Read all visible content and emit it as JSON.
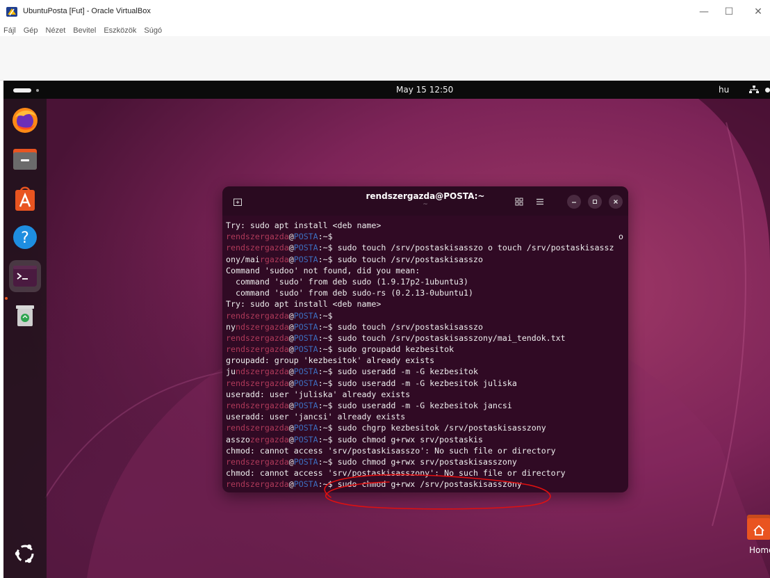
{
  "host": {
    "title": "UbuntuPosta [Fut] - Oracle VirtualBox",
    "menu": [
      "Fájl",
      "Gép",
      "Nézet",
      "Bevitel",
      "Eszközök",
      "Súgó"
    ],
    "controls": {
      "minimize": "—",
      "maximize": "☐",
      "close": "✕"
    }
  },
  "guest": {
    "topbar": {
      "clock": "May 15  12:50",
      "lang": "hu"
    },
    "dock": {
      "items": [
        "firefox-icon",
        "files-icon",
        "app-center-icon",
        "help-icon",
        "terminal-icon",
        "trash-icon"
      ],
      "show_apps": "ubuntu-logo-icon"
    },
    "desktop": {
      "home_label": "Home"
    }
  },
  "terminal": {
    "title": "rendszergazda@POSTA:~",
    "subtitle": "~",
    "prompt": {
      "user": "rendszergazda",
      "at": "@",
      "host": "POSTA",
      "path": ":~$"
    },
    "lines": [
      {
        "pre": "Try: sudo apt install <deb name>"
      },
      {
        "prompt": true,
        "cmd": "",
        "right": "o"
      },
      {
        "prompt": true,
        "cmd": " sudo touch /srv/postaskisasszo o touch /srv/postaskisassz"
      },
      {
        "pre": "ony/mai",
        "prompt": true,
        "short": "rgazda",
        "cmd": " sudo touch /srv/postaskisasszo"
      },
      {
        "pre": "Command 'sudoo' not found, did you mean:"
      },
      {
        "pre": "  command 'sudo' from deb sudo (1.9.17p2-1ubuntu3)"
      },
      {
        "pre": "  command 'sudo' from deb sudo-rs (0.2.13-0ubuntu1)"
      },
      {
        "pre": "Try: sudo apt install <deb name>"
      },
      {
        "prompt": true,
        "cmd": ""
      },
      {
        "pre": "ny",
        "prompt": true,
        "short": "ndszergazda",
        "cmd": " sudo touch /srv/postaskisasszo"
      },
      {
        "prompt": true,
        "cmd": " sudo touch /srv/postaskisasszony/mai_tendok.txt"
      },
      {
        "prompt": true,
        "cmd": " sudo groupadd kezbesitok"
      },
      {
        "pre": "groupadd: group 'kezbesitok' already exists"
      },
      {
        "pre": "ju",
        "prompt": true,
        "short": "ndszergazda",
        "cmd": " sudo useradd -m -G kezbesitok"
      },
      {
        "prompt": true,
        "cmd": " sudo useradd -m -G kezbesitok juliska"
      },
      {
        "pre": "useradd: user 'juliska' already exists"
      },
      {
        "prompt": true,
        "cmd": " sudo useradd -m -G kezbesitok jancsi"
      },
      {
        "pre": "useradd: user 'jancsi' already exists"
      },
      {
        "prompt": true,
        "cmd": " sudo chgrp kezbesitok /srv/postaskisasszony"
      },
      {
        "pre": "asszo",
        "prompt": true,
        "short": "zergazda",
        "cmd": " sudo chmod g+rwx srv/postaskis"
      },
      {
        "pre": "chmod: cannot access 'srv/postaskisasszo': No such file or directory"
      },
      {
        "prompt": true,
        "cmd": " sudo chmod g+rwx srv/postaskisasszony"
      },
      {
        "pre": "chmod: cannot access 'srv/postaskisasszony': No such file or directory"
      },
      {
        "prompt": true,
        "cmd": " sudo chmod g+rwx /srv/postaskisasszony"
      }
    ]
  },
  "colors": {
    "terminal_bg": "#300a24",
    "prompt_user": "#b03a5a",
    "prompt_host": "#3d6fc0",
    "annotation": "#e01010",
    "ubuntu_accent": "#e95420"
  }
}
